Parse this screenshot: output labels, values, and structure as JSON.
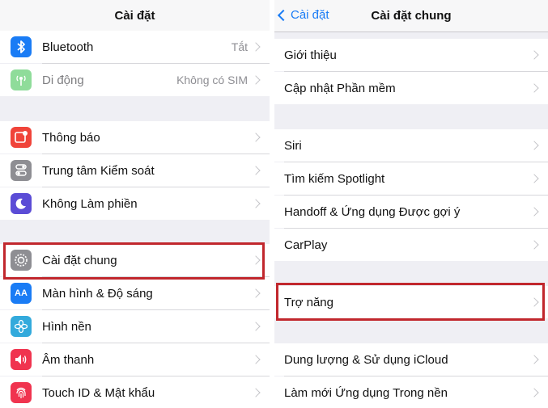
{
  "left": {
    "title": "Cài đặt",
    "rows": [
      {
        "label": "Bluetooth",
        "value": "Tắt",
        "icon": "bluetooth-icon",
        "color": "#1a7cf5"
      },
      {
        "label": "Di động",
        "value": "Không có SIM",
        "icon": "cellular-icon",
        "color": "#8fdc9a",
        "dim": true
      },
      {
        "label": "Thông báo",
        "value": "",
        "icon": "notifications-icon",
        "color": "#f0443a"
      },
      {
        "label": "Trung tâm Kiểm soát",
        "value": "",
        "icon": "control-center-icon",
        "color": "#8e8e93"
      },
      {
        "label": "Không Làm phiền",
        "value": "",
        "icon": "moon-icon",
        "color": "#5b4cd6"
      },
      {
        "label": "Cài đặt chung",
        "value": "",
        "icon": "gear-icon",
        "color": "#8e8e93"
      },
      {
        "label": "Màn hình & Độ sáng",
        "value": "",
        "icon": "display-brightness-icon",
        "color": "#1a7cf5"
      },
      {
        "label": "Hình nền",
        "value": "",
        "icon": "wallpaper-icon",
        "color": "#33aadc"
      },
      {
        "label": "Âm thanh",
        "value": "",
        "icon": "sound-icon",
        "color": "#f0344f"
      },
      {
        "label": "Touch ID & Mật khẩu",
        "value": "",
        "icon": "fingerprint-icon",
        "color": "#f0344f"
      }
    ]
  },
  "right": {
    "back_label": "Cài đặt",
    "title": "Cài đặt chung",
    "rows": [
      {
        "label": "Giới thiệu"
      },
      {
        "label": "Cập nhật Phần mềm"
      },
      {
        "label": "Siri"
      },
      {
        "label": "Tìm kiếm Spotlight"
      },
      {
        "label": "Handoff & Ứng dụng Được gợi ý"
      },
      {
        "label": "CarPlay"
      },
      {
        "label": "Trợ năng"
      },
      {
        "label": "Dung lượng & Sử dụng iCloud"
      },
      {
        "label": "Làm mới Ứng dụng Trong nền"
      }
    ]
  },
  "highlight_color": "#c1272d"
}
